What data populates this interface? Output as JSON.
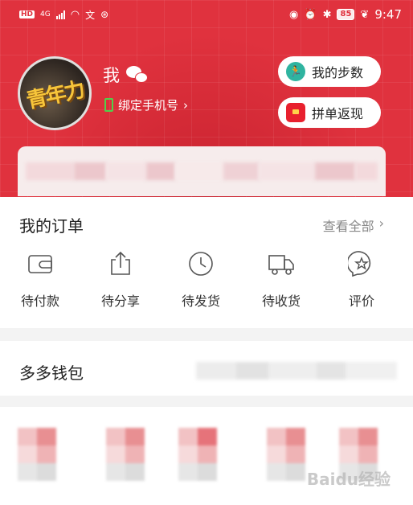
{
  "status_bar": {
    "left_badge": "HD",
    "network": "4G",
    "right_icons": [
      "eye-icon",
      "alarm-icon",
      "bluetooth-icon",
      "battery-icon",
      "leaf-icon"
    ],
    "battery": "85",
    "time": "9:47"
  },
  "profile": {
    "avatar_text": "青年力",
    "username": "我",
    "bind_phone": "绑定手机号",
    "chevron": "›"
  },
  "actions": {
    "steps_label": "我的步数",
    "pdd_label": "拼单返现"
  },
  "orders": {
    "title": "我的订单",
    "view_all": "查看全部",
    "view_all_chevron": "›",
    "items": [
      {
        "label": "待付款",
        "icon": "wallet-icon"
      },
      {
        "label": "待分享",
        "icon": "share-icon"
      },
      {
        "label": "待发货",
        "icon": "clock-icon"
      },
      {
        "label": "待收货",
        "icon": "truck-icon"
      },
      {
        "label": "评价",
        "icon": "review-icon"
      }
    ]
  },
  "wallet": {
    "title": "多多钱包"
  },
  "watermark": "Baidu经验",
  "colors": {
    "brand_red": "#e0323e",
    "accent_green": "#2fb4a0",
    "gray_text": "#888888"
  }
}
